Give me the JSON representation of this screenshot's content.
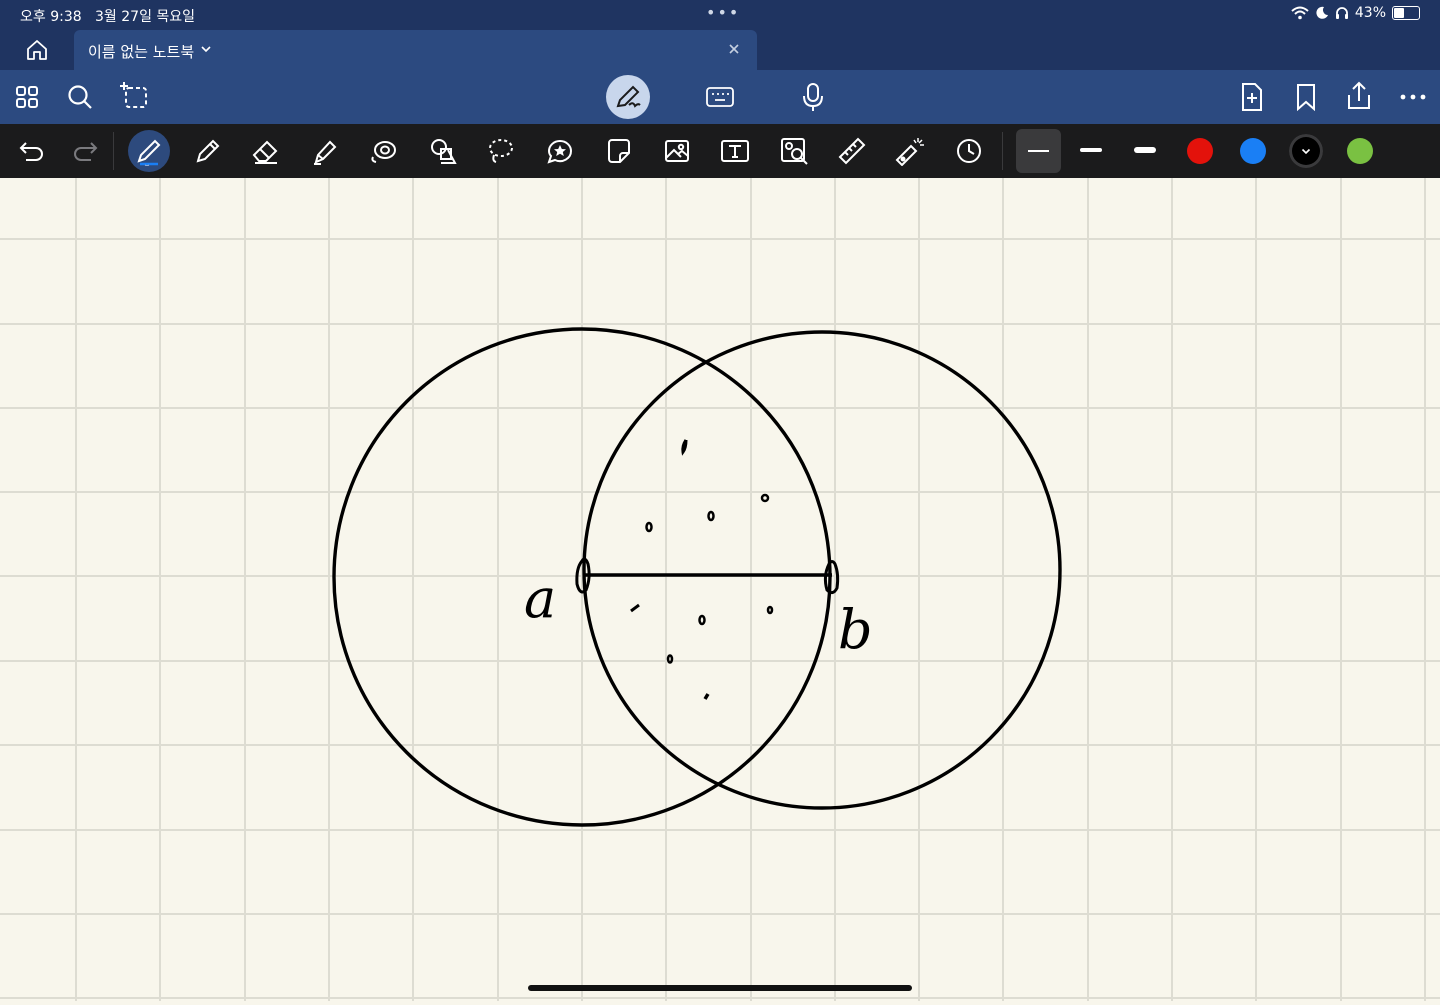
{
  "status_bar": {
    "time": "오후 9:38",
    "date": "3월 27일 목요일",
    "battery_text": "43%",
    "battery_level": 0.43,
    "icons": [
      "wifi-icon",
      "moon-icon",
      "headphones-icon",
      "battery-icon"
    ]
  },
  "tab": {
    "title": "이름 없는 노트북"
  },
  "main_toolbar": {
    "left_icons": [
      "grid-icon",
      "search-icon",
      "shapes-lasso-icon"
    ],
    "center_icons": [
      "pen-mode-icon",
      "keyboard-icon",
      "microphone-icon"
    ],
    "right_icons": [
      "add-page-icon",
      "bookmark-icon",
      "share-icon",
      "more-icon"
    ]
  },
  "tools": [
    "undo",
    "redo",
    "pen",
    "pencil",
    "eraser",
    "highlighter",
    "spiral",
    "shapes",
    "lasso",
    "sticker",
    "stickynote",
    "image",
    "textbox",
    "image-search",
    "ruler",
    "laser-pointer",
    "history"
  ],
  "selected_tool": "pen",
  "stroke_widths": [
    "thin",
    "medium",
    "thick"
  ],
  "colors": {
    "red": "#e3120b",
    "blue": "#1a7ff5",
    "black": "#000000",
    "green": "#7ac142",
    "topbar": "#1f3461",
    "toolbar_dark": "#1b1b1c",
    "paper": "#f8f6ec",
    "grid": "#dddcd2"
  },
  "drawing": {
    "label_a": "a",
    "label_b": "b"
  }
}
